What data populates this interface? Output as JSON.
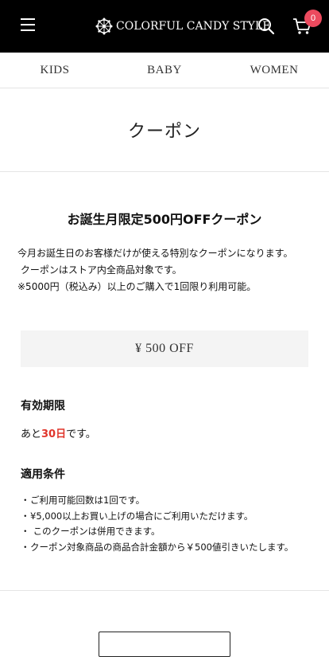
{
  "header": {
    "brand": "COLORFUL CANDY STYLE",
    "cart_count": "0",
    "icons": {
      "menu": "hamburger-menu-icon",
      "search": "search-icon",
      "cart": "cart-icon",
      "logo": "ferris-wheel-logo-icon"
    }
  },
  "nav": {
    "items": [
      {
        "label": "KIDS"
      },
      {
        "label": "BABY"
      },
      {
        "label": "WOMEN"
      }
    ]
  },
  "page": {
    "title": "クーポン"
  },
  "coupon": {
    "title": "お誕生月限定500円OFFクーポン",
    "description": [
      "今月お誕生日のお客様だけが使える特別なクーポンになります。",
      " クーポンはストア内全商品対象です。",
      "※5000円（税込み）以上のご購入で1回限り利用可能。"
    ],
    "amount": "¥ 500 OFF",
    "expiry_heading": "有効期限",
    "expiry_prefix": "あと",
    "expiry_days": "30日",
    "expiry_suffix": "です。",
    "conditions_heading": "適用条件",
    "conditions": [
      "ご利用可能回数は1回です。",
      "¥5,000以上お買い上げの場合にご利用いただけます。",
      " このクーポンは併用できます。",
      "クーポン対象商品の商品合計金額から￥500値引きいたします。"
    ]
  },
  "colors": {
    "header_bg": "#000000",
    "badge": "#ec4a5e",
    "highlight": "#e0352b",
    "amount_bg": "#f4f4f4"
  }
}
